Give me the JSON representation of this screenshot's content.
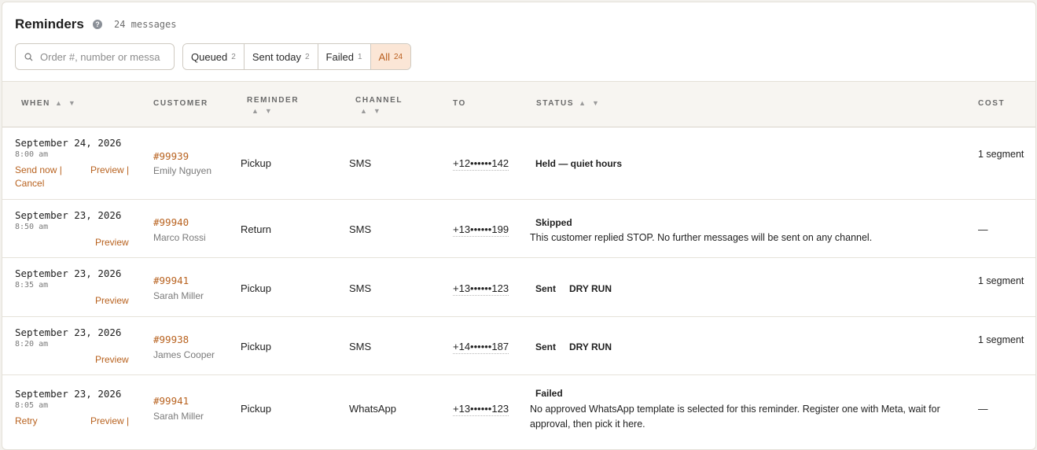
{
  "header": {
    "title": "Reminders",
    "message_count": "24 messages"
  },
  "search": {
    "placeholder": "Order #, number or messa"
  },
  "filters": [
    {
      "label": "Queued",
      "count": "2"
    },
    {
      "label": "Sent today",
      "count": "2"
    },
    {
      "label": "Failed",
      "count": "1"
    },
    {
      "label": "All",
      "count": "24"
    }
  ],
  "columns": {
    "when": "WHEN",
    "customer": "CUSTOMER",
    "reminder": "REMINDER",
    "channel": "CHANNEL",
    "to": "TO",
    "status": "STATUS",
    "cost": "COST"
  },
  "rows": [
    {
      "date": "September 24, 2026",
      "time": "8:00 am",
      "actions": [
        "Send now |",
        "Preview |",
        "Cancel"
      ],
      "order": "#99939",
      "customer": "Emily Nguyen",
      "reminder": "Pickup",
      "channel": "SMS",
      "to": "+12••••••142",
      "status": "Held — quiet hours",
      "status_tag": "",
      "status_detail": "",
      "cost": "1 segment"
    },
    {
      "date": "September 23, 2026",
      "time": "8:50 am",
      "actions": [
        "Preview"
      ],
      "order": "#99940",
      "customer": "Marco Rossi",
      "reminder": "Return",
      "channel": "SMS",
      "to": "+13••••••199",
      "status": "Skipped",
      "status_tag": "",
      "status_detail": "This customer replied STOP. No further messages will be sent on any channel.",
      "cost": "—"
    },
    {
      "date": "September 23, 2026",
      "time": "8:35 am",
      "actions": [
        "Preview"
      ],
      "order": "#99941",
      "customer": "Sarah Miller",
      "reminder": "Pickup",
      "channel": "SMS",
      "to": "+13••••••123",
      "status": "Sent",
      "status_tag": "DRY RUN",
      "status_detail": "",
      "cost": "1 segment"
    },
    {
      "date": "September 23, 2026",
      "time": "8:20 am",
      "actions": [
        "Preview"
      ],
      "order": "#99938",
      "customer": "James Cooper",
      "reminder": "Pickup",
      "channel": "SMS",
      "to": "+14••••••187",
      "status": "Sent",
      "status_tag": "DRY RUN",
      "status_detail": "",
      "cost": "1 segment"
    },
    {
      "date": "September 23, 2026",
      "time": "8:05 am",
      "actions": [
        "Retry",
        "Preview |"
      ],
      "order": "#99941",
      "customer": "Sarah Miller",
      "reminder": "Pickup",
      "channel": "WhatsApp",
      "to": "+13••••••123",
      "status": "Failed",
      "status_tag": "",
      "status_detail": "No approved WhatsApp template is selected for this reminder. Register one with Meta, wait for approval, then pick it here.",
      "cost": "—"
    }
  ]
}
